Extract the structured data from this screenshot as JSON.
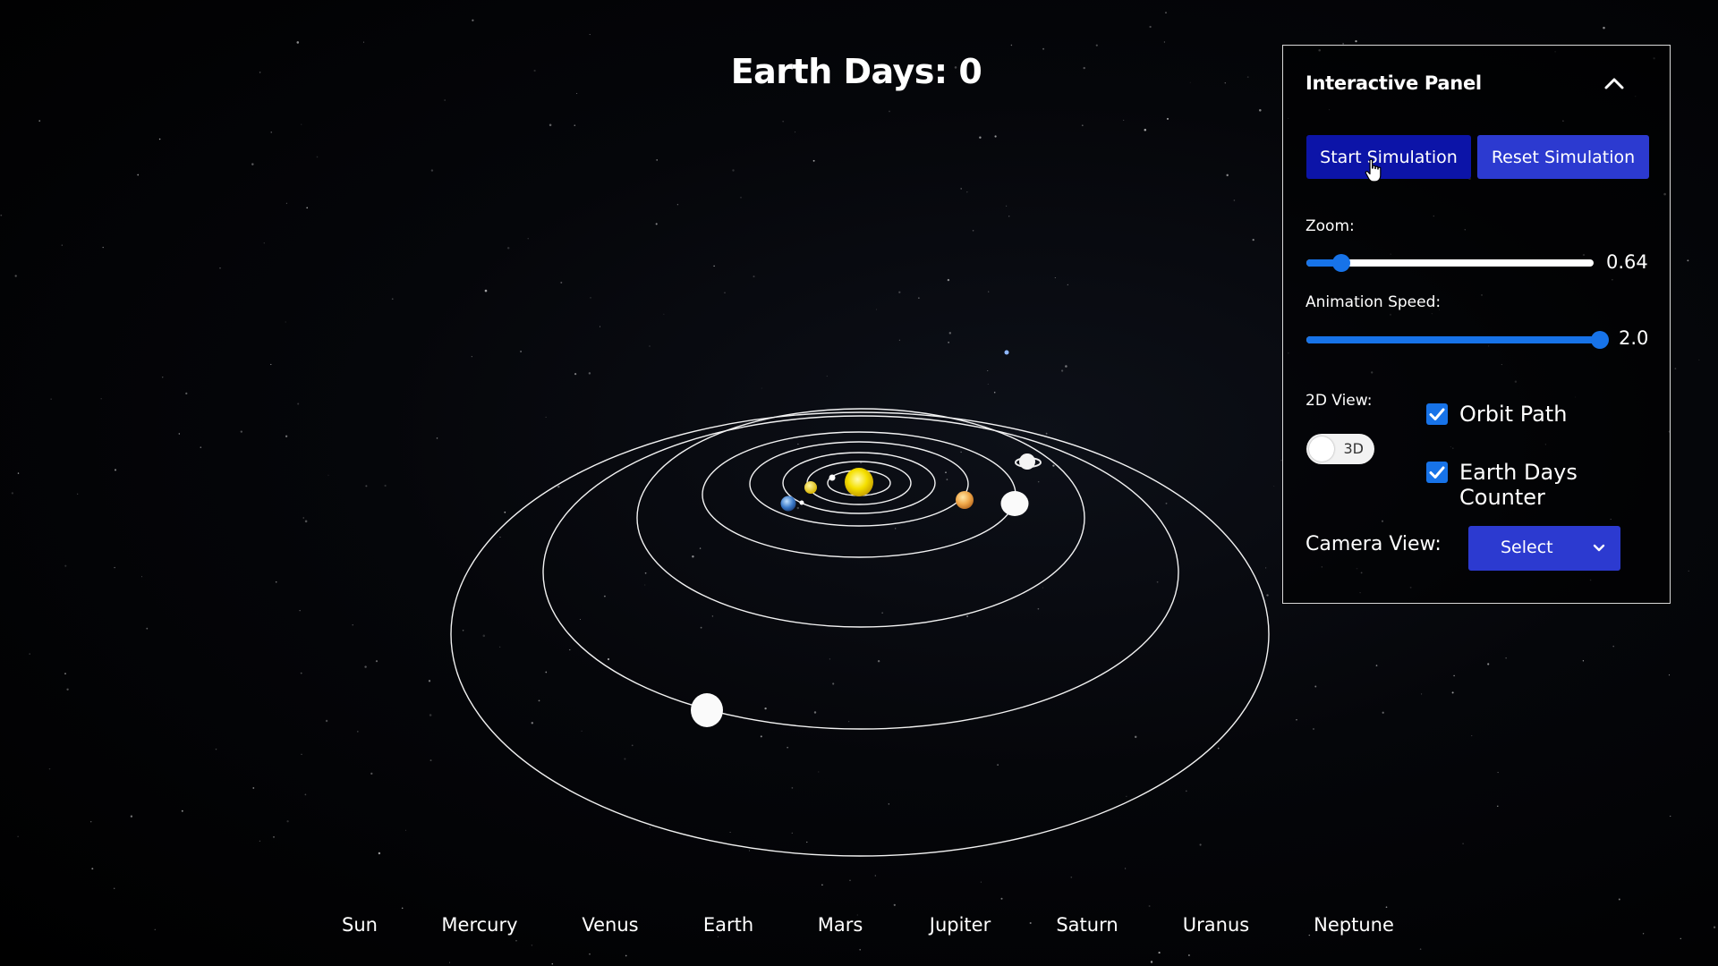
{
  "counter": {
    "label": "Earth Days:",
    "value": "0"
  },
  "panel": {
    "title": "Interactive Panel",
    "collapse_icon": "chevron-up-icon",
    "start_label": "Start Simulation",
    "reset_label": "Reset Simulation",
    "zoom": {
      "label": "Zoom:",
      "value": "0.64",
      "fraction": 0.12
    },
    "speed": {
      "label": "Animation Speed:",
      "value": "2.0",
      "fraction": 1.0
    },
    "view_toggle": {
      "label": "2D View:",
      "state_text": "3D",
      "checked": false
    },
    "orbit_path": {
      "label": "Orbit Path",
      "checked": true
    },
    "days_counter": {
      "label": "Earth Days Counter",
      "checked": true
    },
    "camera": {
      "label": "Camera View:",
      "selected": "Select",
      "icon": "chevron-down-icon"
    }
  },
  "planets": [
    "Sun",
    "Mercury",
    "Venus",
    "Earth",
    "Mars",
    "Jupiter",
    "Saturn",
    "Uranus",
    "Neptune"
  ],
  "colors": {
    "start_button": "#0c14a8",
    "reset_button": "#2c3ad0",
    "slider_accent": "#1773e8",
    "sun": "#f5e000",
    "orbit_line": "#ffffff"
  }
}
